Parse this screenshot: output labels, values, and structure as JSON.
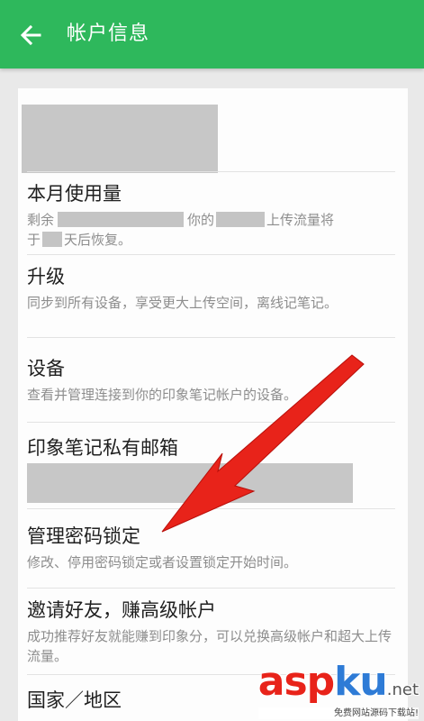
{
  "header": {
    "title": "帐户信息",
    "back_icon": "arrow-left-icon",
    "color": "#2eb85c"
  },
  "items": [
    {
      "title": "本月使用量",
      "desc_parts": [
        "剩余",
        "你的",
        "上传流量将",
        "于",
        "天后恢复。"
      ]
    },
    {
      "title": "升级",
      "desc": "同步到所有设备，享受更大上传空间，离线记笔记。"
    },
    {
      "title": "设备",
      "desc": "查看并管理连接到你的印象笔记帐户的设备。"
    },
    {
      "title": "印象笔记私有邮箱"
    },
    {
      "title": "管理密码锁定",
      "desc": "修改、停用密码锁定或者设置锁定开始时间。"
    },
    {
      "title": "邀请好友，赚高级帐户",
      "desc": "成功推荐好友就能赚到印象分，可以兑换高级帐户和超大上传流量。"
    },
    {
      "title": "国家／地区"
    }
  ],
  "annotation": {
    "arrow_color": "#e8231a"
  },
  "watermark": {
    "main_a": "asp",
    "main_b": "ku",
    "main_c": ".net",
    "sub": "免费网站源码下载站!"
  }
}
